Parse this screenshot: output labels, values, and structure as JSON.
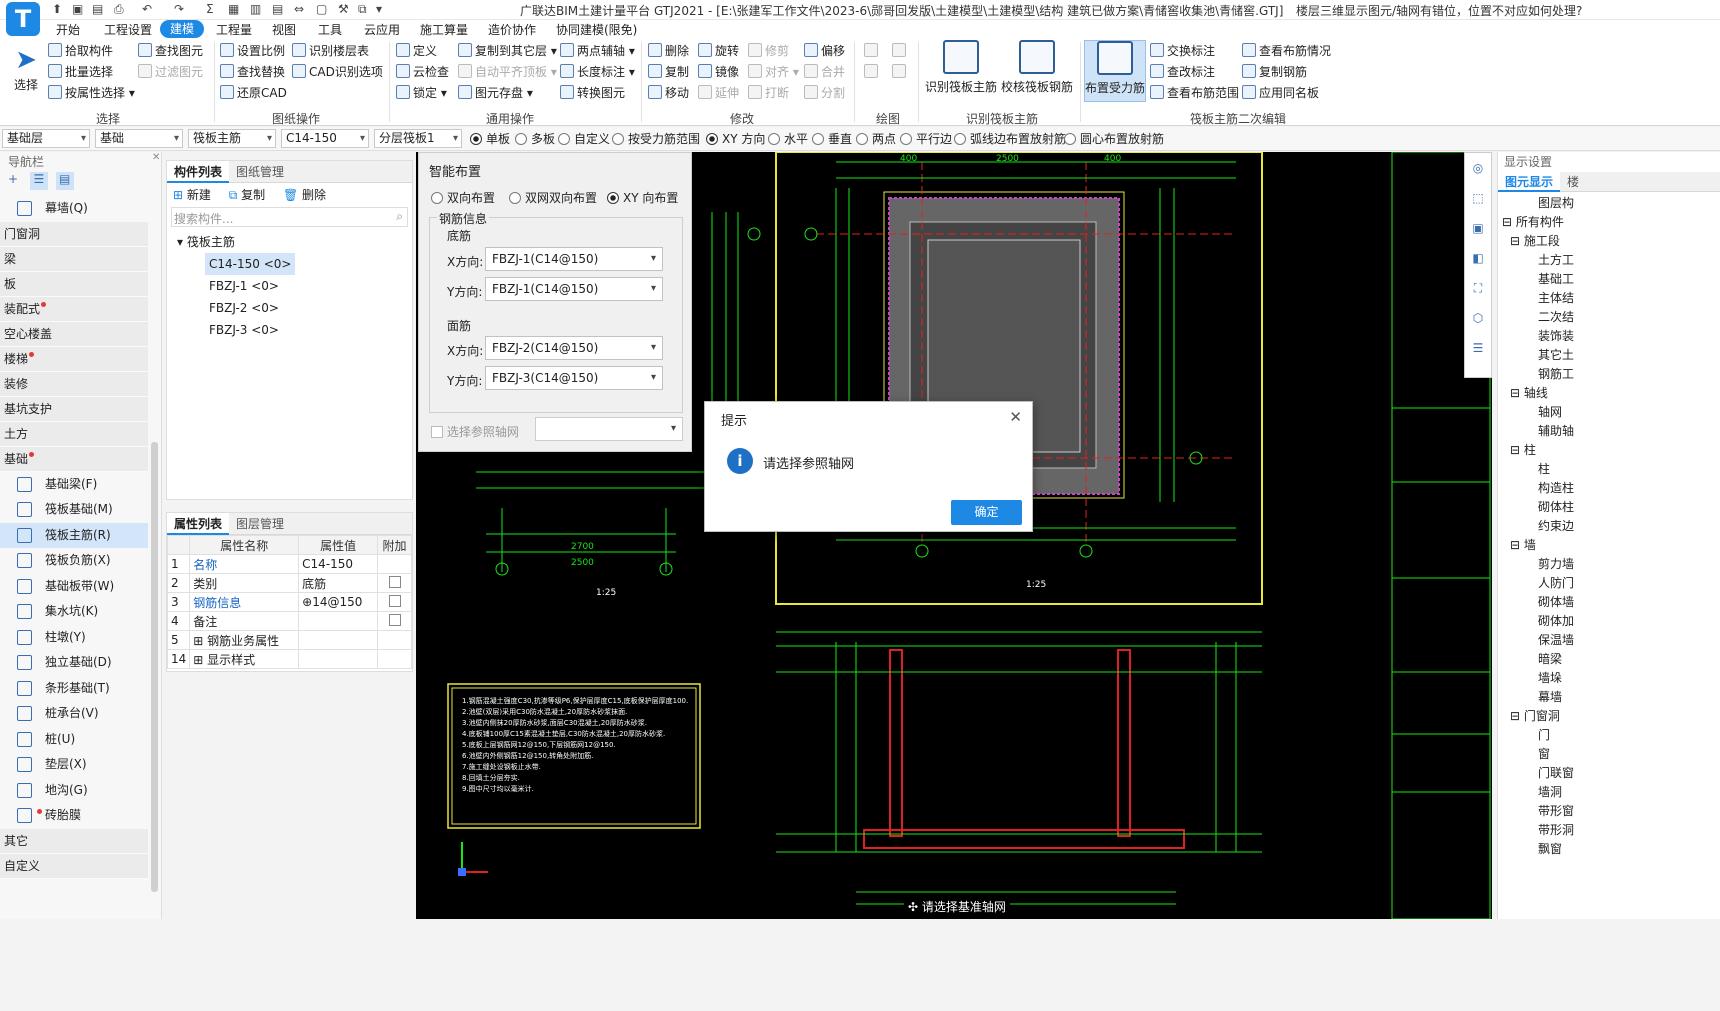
{
  "app": {
    "logo": "T",
    "title": "广联达BIM土建计量平台 GTJ2021 - [E:\\张建军工作文件\\2023-6\\郧哥回发版\\土建模型\\土建模型\\结构 建筑已做方案\\青储窖收集池\\青储窖.GTJ]",
    "help": "楼层三维显示图元/轴网有错位，位置不对应如何处理?"
  },
  "menu": [
    "开始",
    "工程设置",
    "建模",
    "工程量",
    "视图",
    "工具",
    "云应用",
    "施工算量",
    "造价协作",
    "协同建模(限免)"
  ],
  "ribbon": {
    "select": {
      "label": "选择",
      "group": "选择"
    },
    "col1": [
      "拾取构件",
      "批量选择",
      "按属性选择"
    ],
    "col2": [
      "查找图元",
      "过滤图元"
    ],
    "col3": [
      "设置比例",
      "查找替换",
      "还原CAD"
    ],
    "col4": [
      "识别楼层表",
      "CAD识别选项"
    ],
    "group_drawing": "图纸操作",
    "col5": [
      "定义",
      "云检查",
      "锁定"
    ],
    "col6": [
      "复制到其它层",
      "自动平齐顶板",
      "图元存盘"
    ],
    "col7": [
      "两点辅轴",
      "长度标注",
      "转换图元"
    ],
    "group_general": "通用操作",
    "col8": [
      "删除",
      "复制",
      "移动"
    ],
    "col9": [
      "旋转",
      "镜像",
      "延伸"
    ],
    "col10": [
      "修剪",
      "对齐",
      "打断"
    ],
    "col11": [
      "偏移",
      "合并",
      "分割"
    ],
    "group_modify": "修改",
    "group_draw": "绘图",
    "big1": "识别筏板主筋",
    "big2": "校核筏板钢筋",
    "big3": "布置受力筋",
    "group_identify": "识别筏板主筋",
    "col12": [
      "交换标注",
      "查改标注",
      "查看布筋范围"
    ],
    "col13": [
      "查看布筋情况",
      "复制钢筋",
      "应用同名板"
    ],
    "group_second": "筏板主筋二次编辑"
  },
  "toolrow": {
    "combos": [
      "基础层",
      "基础",
      "筏板主筋",
      "C14-150",
      "分层筏板1"
    ],
    "radios": [
      "单板",
      "多板",
      "自定义",
      "按受力筋范围",
      "XY 方向",
      "水平",
      "垂直",
      "两点",
      "平行边",
      "弧线边布置放射筋",
      "圆心布置放射筋"
    ]
  },
  "nav": {
    "title": "导航栏",
    "top_item": "幕墙(Q)",
    "cats": [
      "门窗洞",
      "梁",
      "板",
      "装配式",
      "空心楼盖",
      "楼梯",
      "装修",
      "基坑支护",
      "土方",
      "基础"
    ],
    "items": [
      "基础梁(F)",
      "筏板基础(M)",
      "筏板主筋(R)",
      "筏板负筋(X)",
      "基础板带(W)",
      "集水坑(K)",
      "柱墩(Y)",
      "独立基础(D)",
      "条形基础(T)",
      "桩承台(V)",
      "桩(U)",
      "垫层(X)",
      "地沟(G)",
      "砖胎膜"
    ],
    "bottom": [
      "其它",
      "自定义"
    ]
  },
  "comp": {
    "tabs": [
      "构件列表",
      "图纸管理"
    ],
    "actions": [
      "新建",
      "复制",
      "删除"
    ],
    "search_placeholder": "搜索构件...",
    "root": "筏板主筋",
    "items": [
      "C14-150 <0>",
      "FBZJ-1 <0>",
      "FBZJ-2 <0>",
      "FBZJ-3 <0>"
    ]
  },
  "prop": {
    "tabs": [
      "属性列表",
      "图层管理"
    ],
    "headers": [
      "属性名称",
      "属性值",
      "附加"
    ],
    "rows": [
      {
        "no": "1",
        "name": "名称",
        "value": "C14-150"
      },
      {
        "no": "2",
        "name": "类别",
        "value": "底筋"
      },
      {
        "no": "3",
        "name": "钢筋信息",
        "value": "⊕14@150"
      },
      {
        "no": "4",
        "name": "备注",
        "value": ""
      },
      {
        "no": "5",
        "name": "钢筋业务属性",
        "value": ""
      },
      {
        "no": "14",
        "name": "显示样式",
        "value": ""
      }
    ]
  },
  "smart": {
    "title": "智能布置",
    "modes": [
      "双向布置",
      "双网双向布置",
      "XY 向布置"
    ],
    "rebar_info": "钢筋信息",
    "bottom": "底筋",
    "top": "面筋",
    "xdir": "X方向:",
    "ydir": "Y方向:",
    "bottom_x": "FBZJ-1(C14@150)",
    "bottom_y": "FBZJ-1(C14@150)",
    "top_x": "FBZJ-2(C14@150)",
    "top_y": "FBZJ-3(C14@150)",
    "ref_axis": "选择参照轴网"
  },
  "dialog": {
    "title": "提示",
    "message": "请选择参照轴网",
    "ok": "确定"
  },
  "canvas": {
    "hint": "请选择基准轴网",
    "dims_top": [
      "400",
      "2500",
      "400"
    ],
    "dims_bottom": [
      "2500",
      "2700"
    ],
    "scale_label": "1:25",
    "notes": [
      "1.钢筋混凝土强度C30,抗渗等级P6,保护层厚度C15,底板保护层厚度100.",
      "2.池壁(双层)采用C30防水混凝土,20厚防水砂浆抹面.",
      "3.池壁内侧抹20厚防水砂浆,面层C30混凝土,20厚防水砂浆.",
      "4.底板铺100厚C15素混凝土垫层,C30防水混凝土,20厚防水砂浆.",
      "5.底板上层钢筋网12@150,下层钢筋网12@150.",
      "6.池壁内外侧钢筋12@150,转角处附加筋.",
      "7.施工缝处设钢板止水带.",
      "8.回填土分层夯实.",
      "9.图中尺寸均以毫米计."
    ]
  },
  "right": {
    "title": "显示设置",
    "tabs": [
      "图元显示",
      "楼"
    ],
    "items": [
      "图层构",
      "所有构件",
      "施工段",
      "土方工",
      "基础工",
      "主体结",
      "二次结",
      "装饰装",
      "其它土",
      "钢筋工",
      "轴线",
      "轴网",
      "辅助轴",
      "柱",
      "柱",
      "构造柱",
      "砌体柱",
      "约束边",
      "墙",
      "剪力墙",
      "人防门",
      "砌体墙",
      "砌体加",
      "保温墙",
      "暗梁",
      "墙垛",
      "幕墙",
      "门窗洞",
      "门",
      "窗",
      "门联窗",
      "墙洞",
      "带形窗",
      "带形洞",
      "飘窗"
    ]
  },
  "colors": {
    "accent": "#1e88e5",
    "canvas": "#000000",
    "cad_green": "#19e619",
    "cad_yellow": "#e8e83a",
    "cad_red": "#e02020"
  }
}
